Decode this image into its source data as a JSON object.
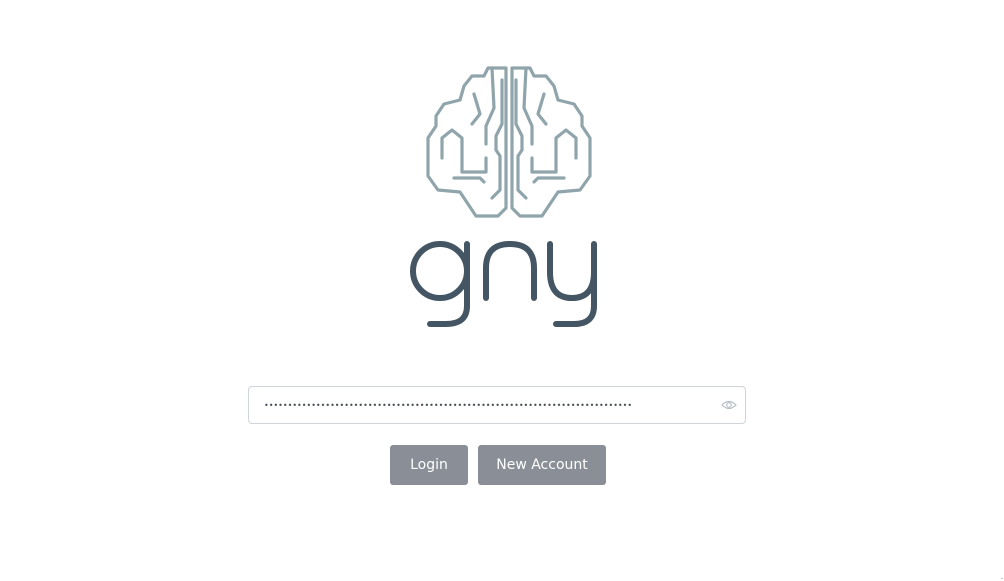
{
  "logo": {
    "icon": "brain-icon",
    "wordmark": "gny",
    "brain_color": "#8fa5ab",
    "wordmark_color": "#445563"
  },
  "login_form": {
    "passphrase_value": "••••••••••••••••••••••••••••••••••••••••••••••••••••••••••••••••••••••••••••••",
    "show_password_icon": "eye-icon",
    "login_label": "Login",
    "new_account_label": "New Account",
    "button_color": "#8a8e96"
  }
}
